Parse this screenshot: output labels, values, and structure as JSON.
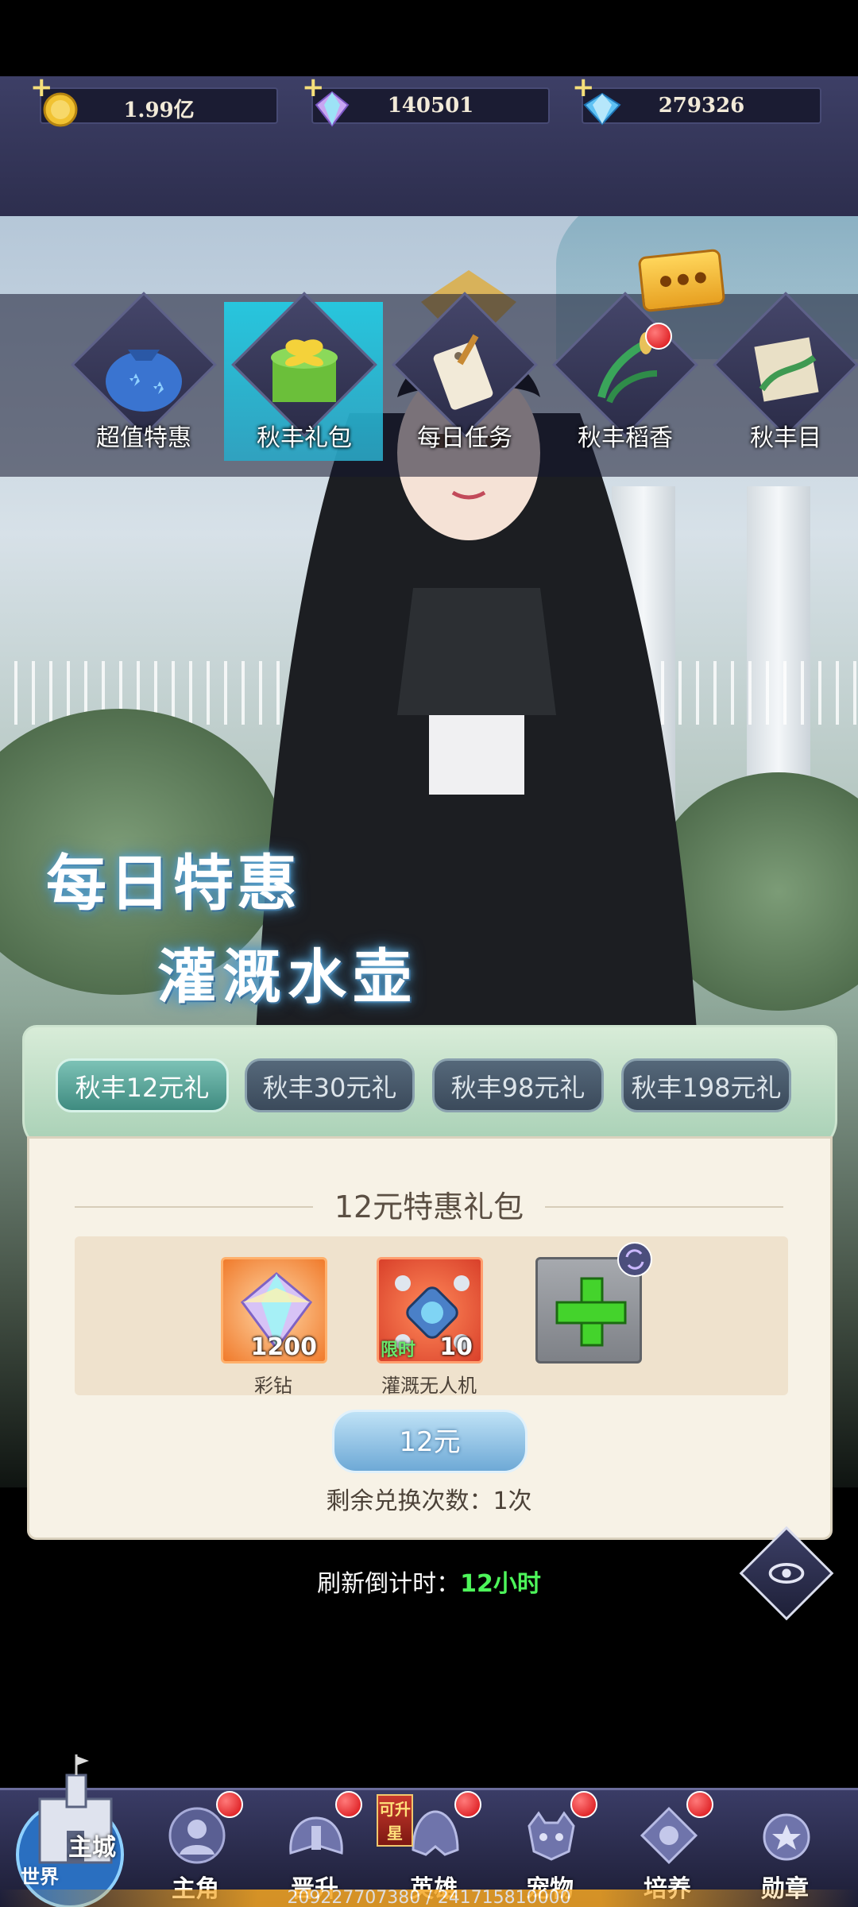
{
  "resources": [
    {
      "name": "gold-coin",
      "value": "1.99亿"
    },
    {
      "name": "rainbow-gem",
      "value": "140501"
    },
    {
      "name": "blue-gem",
      "value": "279326"
    }
  ],
  "event_tabs": [
    {
      "label": "超值特惠"
    },
    {
      "label": "秋丰礼包"
    },
    {
      "label": "每日任务"
    },
    {
      "label": "秋丰稻香"
    },
    {
      "label": "秋丰目"
    }
  ],
  "promo": {
    "line1": "每日特惠",
    "line2": "灌溉水壶"
  },
  "pack_tabs": [
    {
      "label": "秋丰12元礼"
    },
    {
      "label": "秋丰30元礼"
    },
    {
      "label": "秋丰98元礼"
    },
    {
      "label": "秋丰198元礼"
    }
  ],
  "pack": {
    "title": "12元特惠礼包",
    "items": [
      {
        "name": "彩钻",
        "count": "1200",
        "tag": ""
      },
      {
        "name": "灌溉无人机",
        "count": "10",
        "tag": "限时"
      }
    ],
    "price": "12元",
    "remaining": "剩余兑换次数：1次"
  },
  "refresh": {
    "label": "刷新倒计时：",
    "time": "12小时"
  },
  "bottom_nav": {
    "castle": "主城",
    "world": "世界",
    "upgrade_tag": "可升星",
    "items": [
      {
        "label": "主角"
      },
      {
        "label": "晋升"
      },
      {
        "label": "英雄"
      },
      {
        "label": "宠物"
      },
      {
        "label": "培养"
      },
      {
        "label": "勋章"
      }
    ]
  },
  "debug_text": "209227707380 / 241715810000"
}
